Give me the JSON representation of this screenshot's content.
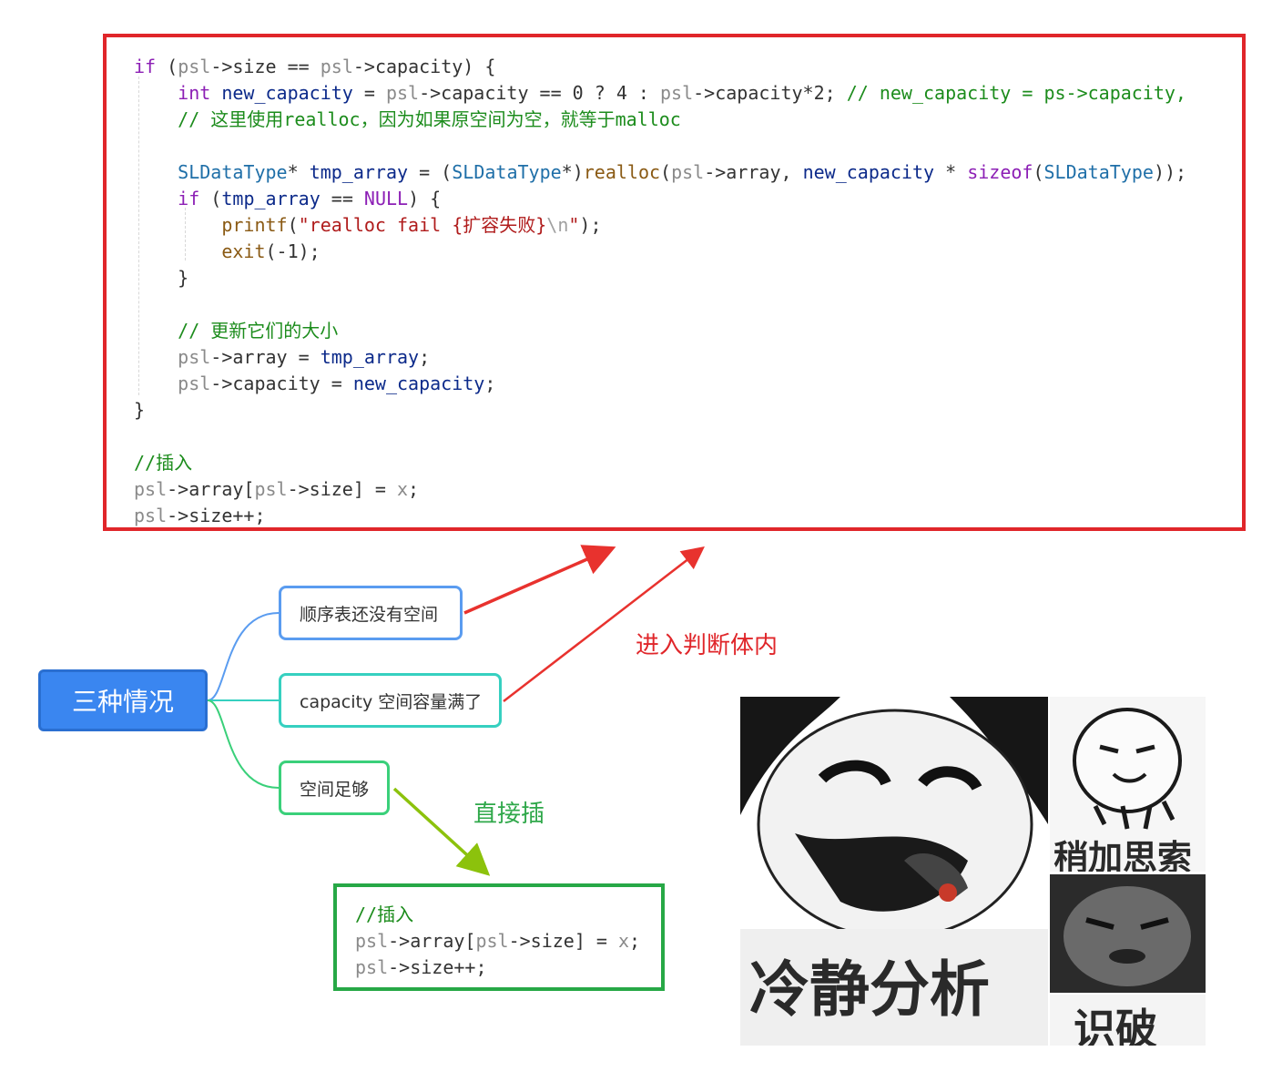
{
  "code_block": {
    "lines": [
      [
        {
          "t": "if",
          "c": "kw"
        },
        {
          "t": " (",
          "c": "nu"
        },
        {
          "t": "psl",
          "c": "psl"
        },
        {
          "t": "->size == ",
          "c": "nu"
        },
        {
          "t": "psl",
          "c": "psl"
        },
        {
          "t": "->capacity) {",
          "c": "nu"
        }
      ],
      [
        {
          "t": "    ",
          "c": "nu"
        },
        {
          "t": "int",
          "c": "kw"
        },
        {
          "t": " ",
          "c": "nu"
        },
        {
          "t": "new_capacity",
          "c": "var"
        },
        {
          "t": " = ",
          "c": "nu"
        },
        {
          "t": "psl",
          "c": "psl"
        },
        {
          "t": "->capacity == 0 ? 4 : ",
          "c": "nu"
        },
        {
          "t": "psl",
          "c": "psl"
        },
        {
          "t": "->capacity*2; ",
          "c": "nu"
        },
        {
          "t": "// new_capacity = ps->capacity,",
          "c": "cm"
        }
      ],
      [
        {
          "t": "    ",
          "c": "nu"
        },
        {
          "t": "// 这里使用realloc，因为如果原空间为空，就等于malloc",
          "c": "cm"
        }
      ],
      [
        {
          "t": "",
          "c": "nu"
        }
      ],
      [
        {
          "t": "    ",
          "c": "nu"
        },
        {
          "t": "SLDataType",
          "c": "ty"
        },
        {
          "t": "* ",
          "c": "nu"
        },
        {
          "t": "tmp_array",
          "c": "var"
        },
        {
          "t": " = (",
          "c": "nu"
        },
        {
          "t": "SLDataType",
          "c": "ty"
        },
        {
          "t": "*)",
          "c": "nu"
        },
        {
          "t": "realloc",
          "c": "fn"
        },
        {
          "t": "(",
          "c": "nu"
        },
        {
          "t": "psl",
          "c": "psl"
        },
        {
          "t": "->array, ",
          "c": "nu"
        },
        {
          "t": "new_capacity",
          "c": "var"
        },
        {
          "t": " * ",
          "c": "nu"
        },
        {
          "t": "sizeof",
          "c": "kw"
        },
        {
          "t": "(",
          "c": "nu"
        },
        {
          "t": "SLDataType",
          "c": "ty"
        },
        {
          "t": "));",
          "c": "nu"
        }
      ],
      [
        {
          "t": "    ",
          "c": "nu"
        },
        {
          "t": "if",
          "c": "kw"
        },
        {
          "t": " (",
          "c": "nu"
        },
        {
          "t": "tmp_array",
          "c": "var"
        },
        {
          "t": " == ",
          "c": "nu"
        },
        {
          "t": "NULL",
          "c": "kw"
        },
        {
          "t": ") {",
          "c": "nu"
        }
      ],
      [
        {
          "t": "        ",
          "c": "nu"
        },
        {
          "t": "printf",
          "c": "fn"
        },
        {
          "t": "(",
          "c": "nu"
        },
        {
          "t": "\"realloc fail {扩容失败}",
          "c": "str"
        },
        {
          "t": "\\n",
          "c": "esc"
        },
        {
          "t": "\"",
          "c": "str"
        },
        {
          "t": ");",
          "c": "nu"
        }
      ],
      [
        {
          "t": "        ",
          "c": "nu"
        },
        {
          "t": "exit",
          "c": "fn"
        },
        {
          "t": "(-1);",
          "c": "nu"
        }
      ],
      [
        {
          "t": "    }",
          "c": "nu"
        }
      ],
      [
        {
          "t": "",
          "c": "nu"
        }
      ],
      [
        {
          "t": "    ",
          "c": "nu"
        },
        {
          "t": "// 更新它们的大小",
          "c": "cm"
        }
      ],
      [
        {
          "t": "    ",
          "c": "nu"
        },
        {
          "t": "psl",
          "c": "psl"
        },
        {
          "t": "->array = ",
          "c": "nu"
        },
        {
          "t": "tmp_array",
          "c": "var"
        },
        {
          "t": ";",
          "c": "nu"
        }
      ],
      [
        {
          "t": "    ",
          "c": "nu"
        },
        {
          "t": "psl",
          "c": "psl"
        },
        {
          "t": "->capacity = ",
          "c": "nu"
        },
        {
          "t": "new_capacity",
          "c": "var"
        },
        {
          "t": ";",
          "c": "nu"
        }
      ],
      [
        {
          "t": "}",
          "c": "nu"
        }
      ],
      [
        {
          "t": "",
          "c": "nu"
        }
      ],
      [
        {
          "t": "//插入",
          "c": "cm"
        }
      ],
      [
        {
          "t": "psl",
          "c": "psl"
        },
        {
          "t": "->array[",
          "c": "nu"
        },
        {
          "t": "psl",
          "c": "psl"
        },
        {
          "t": "->size] = ",
          "c": "nu"
        },
        {
          "t": "x",
          "c": "psl"
        },
        {
          "t": ";",
          "c": "nu"
        }
      ],
      [
        {
          "t": "psl",
          "c": "psl"
        },
        {
          "t": "->size++;",
          "c": "nu"
        }
      ]
    ]
  },
  "mindmap": {
    "root": "三种情况",
    "branch1": "顺序表还没有空间",
    "branch2": "capacity 空间容量满了",
    "branch3": "空间足够"
  },
  "annotations": {
    "enter_label": "进入判断体内",
    "direct_label": "直接插"
  },
  "small_code": {
    "lines": [
      [
        {
          "t": "//插入",
          "c": "cm"
        }
      ],
      [
        {
          "t": "psl",
          "c": "psl"
        },
        {
          "t": "->array[",
          "c": "nu"
        },
        {
          "t": "psl",
          "c": "psl"
        },
        {
          "t": "->size] = ",
          "c": "nu"
        },
        {
          "t": "x",
          "c": "psl"
        },
        {
          "t": ";",
          "c": "nu"
        }
      ],
      [
        {
          "t": "psl",
          "c": "psl"
        },
        {
          "t": "->size++;",
          "c": "nu"
        }
      ]
    ]
  },
  "meme": {
    "caption_main": "冷静分析",
    "caption_right_top": "稍加思索",
    "caption_right_bottom": "识破"
  },
  "colors": {
    "red_border": "#e0262a",
    "green_border": "#27a846",
    "root_blue": "#3a86f0",
    "branch_blue": "#5a9cf0",
    "branch_cyan": "#36d0c0",
    "branch_green": "#3ad07a",
    "arrow_red": "#e8322e",
    "arrow_green": "#8cc20c",
    "label_red": "#e0262a",
    "label_green": "#2fa84a"
  }
}
